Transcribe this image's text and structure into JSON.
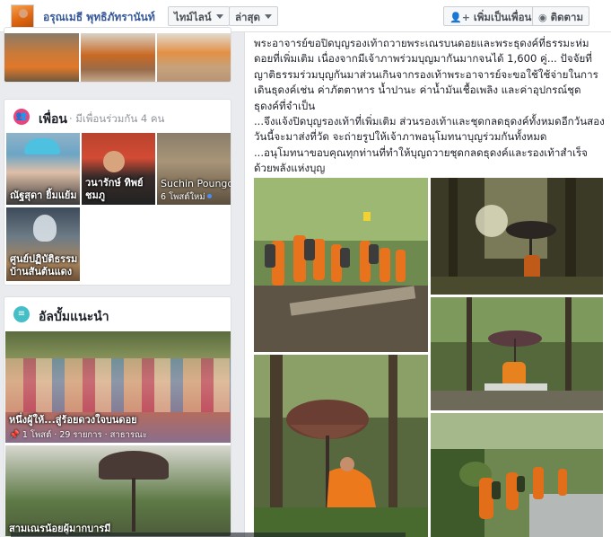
{
  "header": {
    "profile_name": "อรุณเมธี พุทธิภัทรานันท์",
    "timeline_menu": "ไทม์ไลน์",
    "latest_menu": "ล่าสุด",
    "add_friend_button": "เพิ่มเป็นเพื่อน",
    "follow_button": "ติดตาม"
  },
  "friends": {
    "title": "เพื่อน",
    "subtitle": "· มีเพื่อนร่วมกัน 4 คน",
    "items": [
      {
        "name": "ณัฐสุดา ยิ้มแย้ม"
      },
      {
        "name": "วนารักษ์ ทิพย์ ชมภู"
      },
      {
        "name": "Suchin Poungchine",
        "note": "6 โพสต์ใหม่"
      },
      {
        "name": "ศูนย์ปฏิบัติธรรม บ้านสันต้นแดง"
      }
    ]
  },
  "albums": {
    "title": "อัลบั้มแนะนำ",
    "items": [
      {
        "title": "หนึ่งผู้ให้...สู่ร้อยดวงใจบนดอย",
        "meta": "1 โพสต์ · 29 รายการ · สาธารณะ"
      },
      {
        "title": "สามเณรน้อยผู้มากบารมี"
      }
    ]
  },
  "post": {
    "paragraphs": [
      "พระอาจารย์ขอปิดบุญรองเท้าถวายพระเณรบนดอยและพระธุดงค์ที่ธรรมะห่มดอยที่เพิ่มเติม เนื่องจากมีเจ้าภาพร่วมบุญมากันมากจนได้ 1,600 คู่... ปัจจัยที่ญาติธรรมร่วมบุญกันมาส่วนเกินจากรองเท้าพระอาจารย์จะขอใช้ใช้จ่ายในการเดินธุดงค์เช่น ค่าภัตตาหาร น้ำปานะ ค่าน้ำมันเชื้อเพลิง และค่าอุปกรณ์ชุดธุดงค์ที่จำเป็น",
      "...จึงแจ้งปิดบุญรองเท้าที่เพิ่มเติม ส่วนรองเท้าและชุดกลดธุดงค์ทั้งหมดอีกวันสองวันนี้จะมาส่งที่วัด จะถ่ายรูปให้เจ้าภาพอนุโมทนาบุญร่วมกันทั้งหมด",
      "...อนุโมทนาขอบคุณทุกท่านที่ทำให้บุญถวายชุดกลดธุดงค์และรองเท้าสำเร็จด้วยพลังแห่งบุญ"
    ]
  },
  "colors": {
    "link": "#365899",
    "friends_icon": "#e9447c",
    "albums_icon": "#44bec7",
    "robe_orange": "#e8731c"
  }
}
